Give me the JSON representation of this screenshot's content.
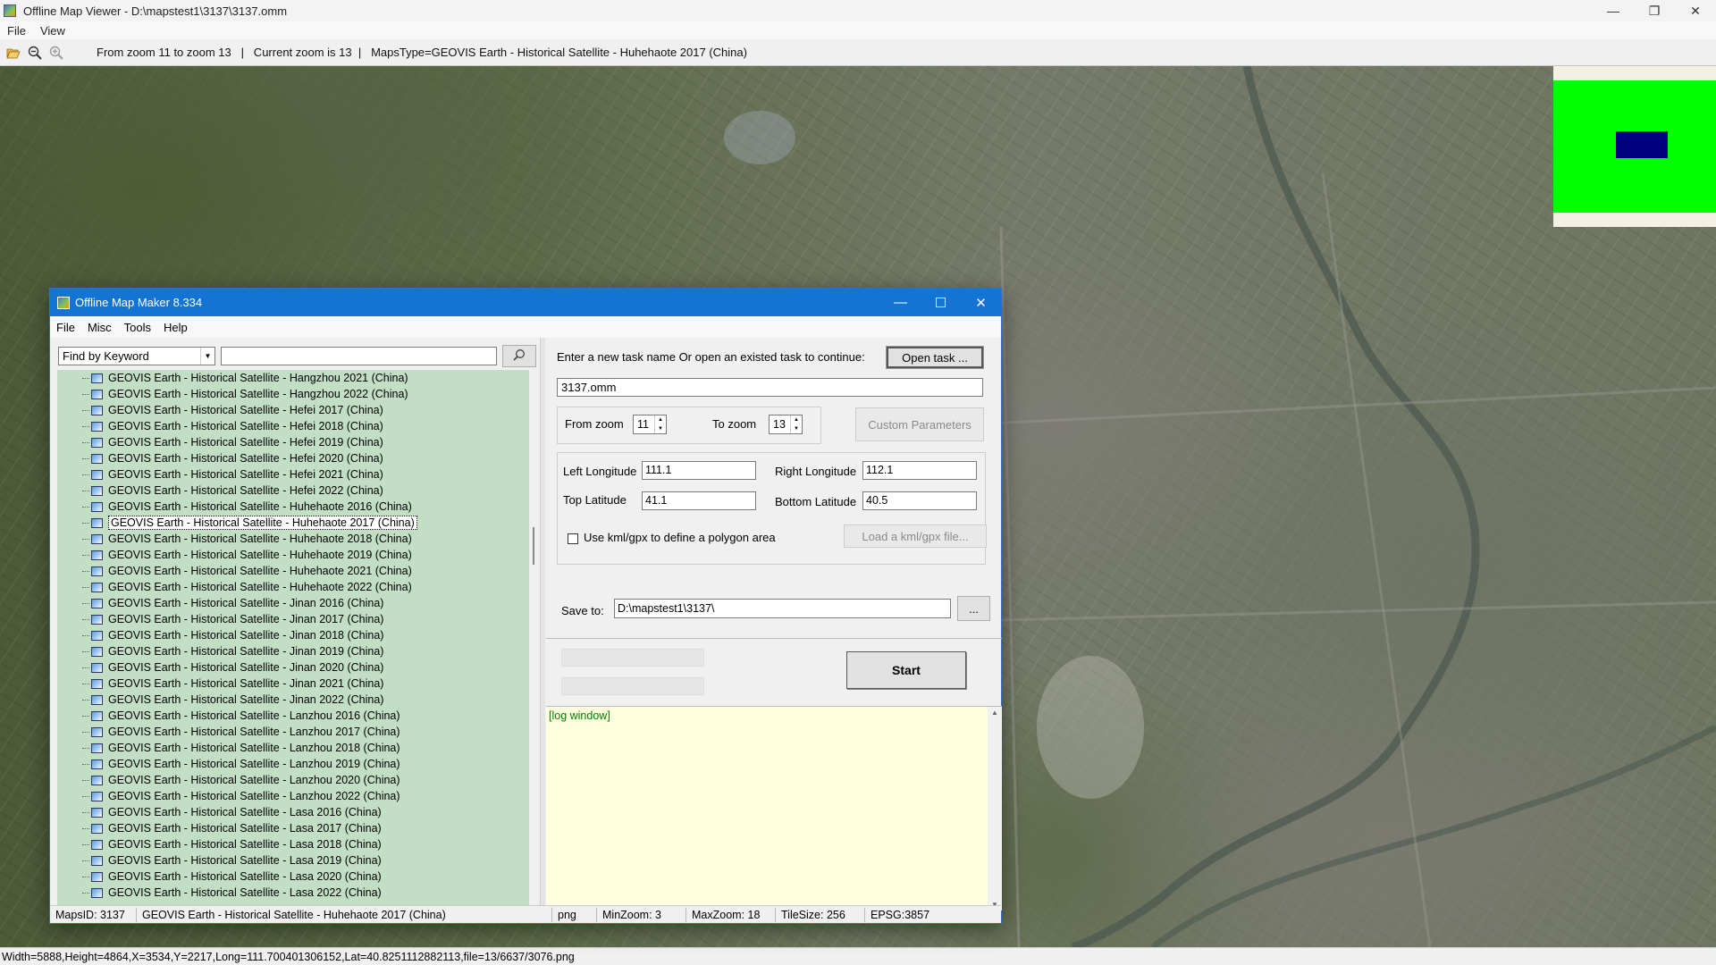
{
  "window": {
    "title": "Offline Map Viewer - D:\\mapstest1\\3137\\3137.omm",
    "minimize": "—",
    "maximize": "❐",
    "close": "✕"
  },
  "menubar": [
    "File",
    "View"
  ],
  "toolbar": {
    "status": "From zoom 11 to zoom 13   |   Current zoom is 13  |   MapsType=GEOVIS Earth - Historical Satellite - Huhehaote 2017 (China)"
  },
  "statusbar": {
    "text": "Width=5888,Height=4864,X=3534,Y=2217,Long=111.700401306152,Lat=40.8251112882113,file=13/6637/3076.png"
  },
  "dialog": {
    "title": "Offline Map Maker 8.334",
    "menu": [
      "File",
      "Misc",
      "Tools",
      "Help"
    ],
    "find": {
      "mode": "Find by Keyword",
      "query": ""
    },
    "tree_items": [
      "GEOVIS Earth - Historical Satellite - Hangzhou 2021 (China)",
      "GEOVIS Earth - Historical Satellite - Hangzhou 2022 (China)",
      "GEOVIS Earth - Historical Satellite - Hefei 2017 (China)",
      "GEOVIS Earth - Historical Satellite - Hefei 2018 (China)",
      "GEOVIS Earth - Historical Satellite - Hefei 2019 (China)",
      "GEOVIS Earth - Historical Satellite - Hefei 2020 (China)",
      "GEOVIS Earth - Historical Satellite - Hefei 2021 (China)",
      "GEOVIS Earth - Historical Satellite - Hefei 2022 (China)",
      "GEOVIS Earth - Historical Satellite - Huhehaote 2016 (China)",
      "GEOVIS Earth - Historical Satellite - Huhehaote 2017 (China)",
      "GEOVIS Earth - Historical Satellite - Huhehaote 2018 (China)",
      "GEOVIS Earth - Historical Satellite - Huhehaote 2019 (China)",
      "GEOVIS Earth - Historical Satellite - Huhehaote 2021 (China)",
      "GEOVIS Earth - Historical Satellite - Huhehaote 2022 (China)",
      "GEOVIS Earth - Historical Satellite - Jinan 2016 (China)",
      "GEOVIS Earth - Historical Satellite - Jinan 2017 (China)",
      "GEOVIS Earth - Historical Satellite - Jinan 2018 (China)",
      "GEOVIS Earth - Historical Satellite - Jinan 2019 (China)",
      "GEOVIS Earth - Historical Satellite - Jinan 2020 (China)",
      "GEOVIS Earth - Historical Satellite - Jinan 2021 (China)",
      "GEOVIS Earth - Historical Satellite - Jinan 2022 (China)",
      "GEOVIS Earth - Historical Satellite - Lanzhou 2016 (China)",
      "GEOVIS Earth - Historical Satellite - Lanzhou 2017 (China)",
      "GEOVIS Earth - Historical Satellite - Lanzhou 2018 (China)",
      "GEOVIS Earth - Historical Satellite - Lanzhou 2019 (China)",
      "GEOVIS Earth - Historical Satellite - Lanzhou 2020 (China)",
      "GEOVIS Earth - Historical Satellite - Lanzhou 2022 (China)",
      "GEOVIS Earth - Historical Satellite - Lasa 2016 (China)",
      "GEOVIS Earth - Historical Satellite - Lasa 2017 (China)",
      "GEOVIS Earth - Historical Satellite - Lasa 2018 (China)",
      "GEOVIS Earth - Historical Satellite - Lasa 2019 (China)",
      "GEOVIS Earth - Historical Satellite - Lasa 2020 (China)",
      "GEOVIS Earth - Historical Satellite - Lasa 2022 (China)"
    ],
    "selected_item": "GEOVIS Earth - Historical Satellite - Huhehaote 2017 (China)",
    "task": {
      "prompt": "Enter a new task name Or open an existed task to continue:",
      "open_label": "Open task ...",
      "name": "3137.omm"
    },
    "zoom": {
      "from_label": "From zoom",
      "from_value": "11",
      "to_label": "To zoom",
      "to_value": "13",
      "custom_label": "Custom Parameters"
    },
    "coords": {
      "left_lon_label": "Left Longitude",
      "left_lon": "111.1",
      "right_lon_label": "Right Longitude",
      "right_lon": "112.1",
      "top_lat_label": "Top Latitude",
      "top_lat": "41.1",
      "bottom_lat_label": "Bottom Latitude",
      "bottom_lat": "40.5",
      "kml_label": "Use kml/gpx to define a polygon area",
      "kml_checked": false,
      "kml_button": "Load a kml/gpx file..."
    },
    "save": {
      "label": "Save to:",
      "path": "D:\\mapstest1\\3137\\",
      "browse": "..."
    },
    "start_label": "Start",
    "log": "[log window]",
    "status": {
      "maps_id": "MapsID: 3137",
      "map_name": "GEOVIS Earth - Historical Satellite - Huhehaote 2017 (China)",
      "format": "png",
      "min_zoom": "MinZoom: 3",
      "max_zoom": "MaxZoom: 18",
      "tile_size": "TileSize: 256",
      "epsg": "EPSG:3857"
    }
  },
  "colors": {
    "tree_bg": "#c2dec4",
    "dialog_titlebar": "#1474d4",
    "overview_green": "#00ff00",
    "overview_rect": "#000080",
    "log_bg": "#ffffe0"
  }
}
